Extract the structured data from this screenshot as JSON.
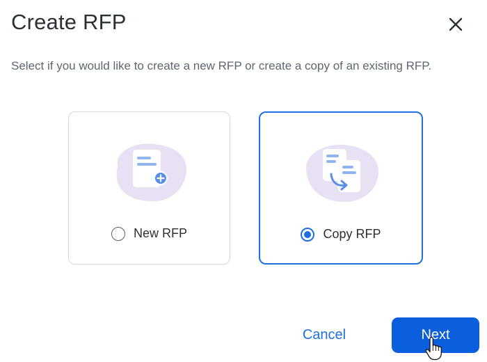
{
  "dialog": {
    "title": "Create RFP",
    "close_icon": "close-icon",
    "subtitle": "Select if you would like to create a new RFP or create a copy of an existing RFP."
  },
  "options": [
    {
      "label": "New RFP",
      "selected": false,
      "icon": "new-document-icon"
    },
    {
      "label": "Copy RFP",
      "selected": true,
      "icon": "copy-document-icon"
    }
  ],
  "footer": {
    "cancel_label": "Cancel",
    "next_label": "Next"
  },
  "colors": {
    "accent": "#1f6fe0",
    "primary_button": "#0b5fdc",
    "illustration_blob": "#e8e1f3",
    "document_line": "#8fb4ee",
    "card_border": "#d4d7dc",
    "title_text": "#2b2f36",
    "subtitle_text": "#5f6670"
  },
  "cursor": "hand-pointer-cursor"
}
